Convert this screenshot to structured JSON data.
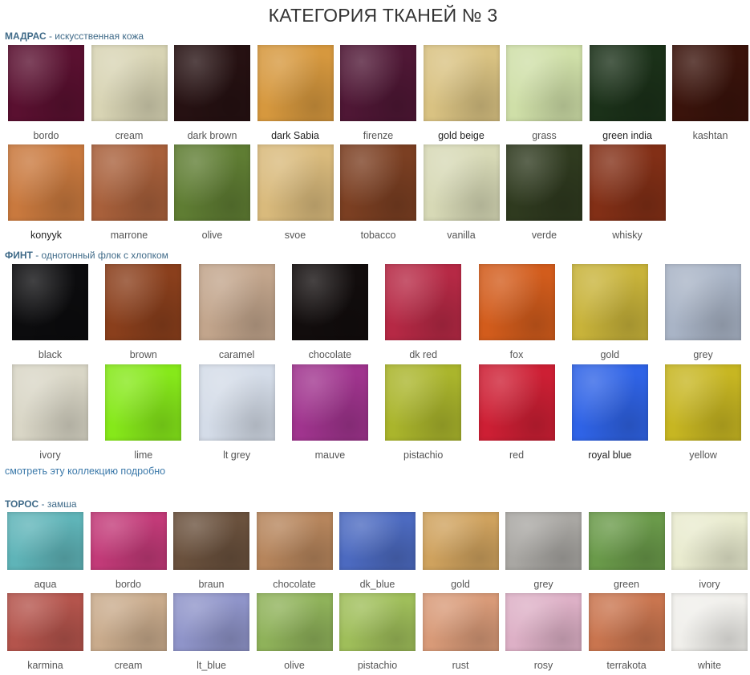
{
  "page": {
    "title": "КАТЕГОРИЯ ТКАНЕЙ № 3"
  },
  "sections": [
    {
      "name": "МАДРАС",
      "description": " - искусственная кожа",
      "swatches": [
        {
          "label": "bordo",
          "color": "#5a1030",
          "dark": false
        },
        {
          "label": "cream",
          "color": "#d8d4b4",
          "dark": false
        },
        {
          "label": "dark brown",
          "color": "#261112",
          "dark": false
        },
        {
          "label": "dark Sabia",
          "color": "#d6983e",
          "dark": true
        },
        {
          "label": "firenze",
          "color": "#4f1735",
          "dark": false
        },
        {
          "label": "gold beige",
          "color": "#d9c282",
          "dark": true
        },
        {
          "label": "grass",
          "color": "#cfdfa8",
          "dark": false
        },
        {
          "label": "green india",
          "color": "#1b3119",
          "dark": true
        },
        {
          "label": "kashtan",
          "color": "#3a130b",
          "dark": false
        },
        {
          "label": "konyyk",
          "color": "#c9793e",
          "dark": true
        },
        {
          "label": "marrone",
          "color": "#a8603b",
          "dark": false
        },
        {
          "label": "olive",
          "color": "#5f7d33",
          "dark": false
        },
        {
          "label": "svoe",
          "color": "#d9ba7c",
          "dark": false
        },
        {
          "label": "tobacco",
          "color": "#7b3f22",
          "dark": false
        },
        {
          "label": "vanilla",
          "color": "#d7d9b6",
          "dark": false
        },
        {
          "label": "verde",
          "color": "#2f3a1f",
          "dark": false
        },
        {
          "label": "whisky",
          "color": "#822f16",
          "dark": false
        }
      ]
    },
    {
      "name": "ФИНТ",
      "description": " - однотонный флок с хлопком",
      "swatches": [
        {
          "label": "black",
          "color": "#0c0c0e",
          "dark": false
        },
        {
          "label": "brown",
          "color": "#8a3f1c",
          "dark": false
        },
        {
          "label": "caramel",
          "color": "#c2a58c",
          "dark": false
        },
        {
          "label": "chocolate",
          "color": "#120d0d",
          "dark": false
        },
        {
          "label": "dk red",
          "color": "#b62945",
          "dark": false
        },
        {
          "label": "fox",
          "color": "#d25c1c",
          "dark": false
        },
        {
          "label": "gold",
          "color": "#c8b33a",
          "dark": false
        },
        {
          "label": "grey",
          "color": "#a9b4c6",
          "dark": false
        },
        {
          "label": "ivory",
          "color": "#d9d6c6",
          "dark": false
        },
        {
          "label": "lime",
          "color": "#86e81a",
          "dark": false
        },
        {
          "label": "lt grey",
          "color": "#d4dce8",
          "dark": false
        },
        {
          "label": "mauve",
          "color": "#a0348e",
          "dark": false
        },
        {
          "label": "pistachio",
          "color": "#aab52c",
          "dark": false
        },
        {
          "label": "red",
          "color": "#cd1f34",
          "dark": false
        },
        {
          "label": "royal blue",
          "color": "#2f63e6",
          "dark": true
        },
        {
          "label": "yellow",
          "color": "#c7b622",
          "dark": false
        }
      ],
      "more_link": "смотреть эту коллекцию подробно"
    },
    {
      "name": "ТОРОС",
      "description": " - замша",
      "swatches": [
        {
          "label": "aqua",
          "color": "#5fb4b8",
          "dark": false
        },
        {
          "label": "bordo",
          "color": "#c23a78",
          "dark": false
        },
        {
          "label": "braun",
          "color": "#6a513d",
          "dark": false
        },
        {
          "label": "chocolate",
          "color": "#b6855c",
          "dark": false
        },
        {
          "label": "dk_blue",
          "color": "#4c6ac0",
          "dark": false
        },
        {
          "label": "gold",
          "color": "#cfa25e",
          "dark": false
        },
        {
          "label": "grey",
          "color": "#a9a7a3",
          "dark": false
        },
        {
          "label": "green",
          "color": "#6a9a4a",
          "dark": false
        },
        {
          "label": "ivory",
          "color": "#e9ebcf",
          "dark": false
        },
        {
          "label": "karmina",
          "color": "#b4544c",
          "dark": false
        },
        {
          "label": "cream",
          "color": "#c9ab8c",
          "dark": false
        },
        {
          "label": "lt_blue",
          "color": "#8f94c9",
          "dark": false
        },
        {
          "label": "olive",
          "color": "#8fb25a",
          "dark": false
        },
        {
          "label": "pistachio",
          "color": "#9fbe5a",
          "dark": false
        },
        {
          "label": "rust",
          "color": "#d89a78",
          "dark": false
        },
        {
          "label": "rosy",
          "color": "#ddb0c6",
          "dark": false
        },
        {
          "label": "terrakota",
          "color": "#c9754f",
          "dark": false
        },
        {
          "label": "white",
          "color": "#f0efeb",
          "dark": false
        }
      ]
    }
  ]
}
